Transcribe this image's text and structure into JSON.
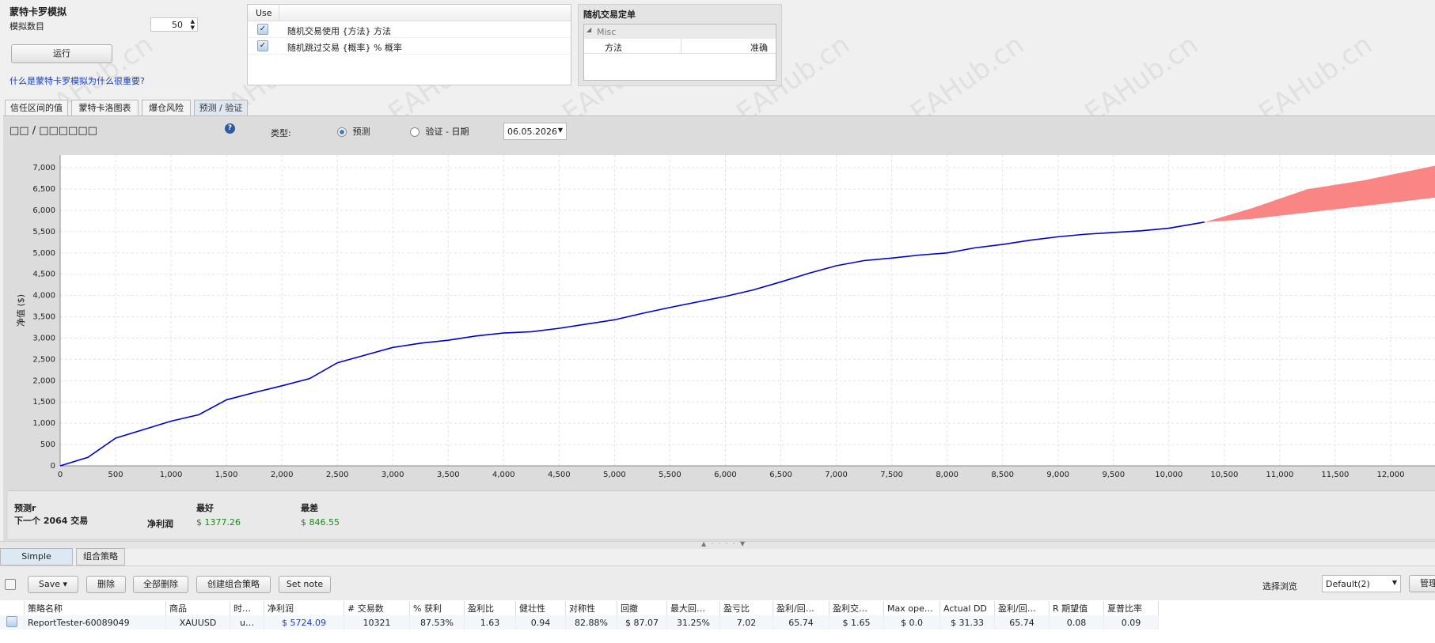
{
  "sim": {
    "title": "蒙特卡罗模拟",
    "count_label": "模拟数目",
    "count_value": "50",
    "run_button": "运行",
    "help_link": "什么是蒙特卡罗模拟为什么很重要?"
  },
  "options_table": {
    "header_use": "Use",
    "rows": [
      {
        "checked": "✓",
        "label": "随机交易使用 {方法} 方法"
      },
      {
        "checked": "✓",
        "label": "随机跳过交易 {概率} % 概率"
      }
    ]
  },
  "props": {
    "title": "随机交易定单",
    "group": "Misc",
    "key": "方法",
    "value": "准确"
  },
  "tabs": [
    "信任区间的值",
    "蒙特卡洛图表",
    "爆仓风险",
    "预测 / 验证"
  ],
  "toolbar": {
    "section_title": "□□ / □□□□□□",
    "help_icon": "?",
    "type_label": "类型:",
    "opt_predict": "预测",
    "opt_validate": "验证 - 日期",
    "date_value": "06.05.2026"
  },
  "chart_data": {
    "type": "line",
    "ylabel": "净值 ($)",
    "xlim": [
      0,
      12400
    ],
    "ylim": [
      0,
      7300
    ],
    "x_ticks": [
      0,
      500,
      1000,
      1500,
      2000,
      2500,
      3000,
      3500,
      4000,
      4500,
      5000,
      5500,
      6000,
      6500,
      7000,
      7500,
      8000,
      8500,
      9000,
      9500,
      10000,
      10500,
      11000,
      11500,
      12000
    ],
    "x_tick_labels": [
      "0",
      "500",
      "1,000",
      "1,500",
      "2,000",
      "2,500",
      "3,000",
      "3,500",
      "4,000",
      "4,500",
      "5,000",
      "5,500",
      "6,000",
      "6,500",
      "7,000",
      "7,500",
      "8,000",
      "8,500",
      "9,000",
      "9,500",
      "10,000",
      "10,500",
      "11,000",
      "11,500",
      "12,000"
    ],
    "y_ticks": [
      0,
      500,
      1000,
      1500,
      2000,
      2500,
      3000,
      3500,
      4000,
      4500,
      5000,
      5500,
      6000,
      6500,
      7000
    ],
    "y_tick_labels": [
      "0",
      "500",
      "1,000",
      "1,500",
      "2,000",
      "2,500",
      "3,000",
      "3,500",
      "4,000",
      "4,500",
      "5,000",
      "5,500",
      "6,000",
      "6,500",
      "7,000"
    ],
    "grid": true,
    "series": [
      {
        "color": "#0000cc",
        "x": [
          0,
          250,
          500,
          750,
          1000,
          1250,
          1500,
          1750,
          2000,
          2250,
          2500,
          2750,
          3000,
          3250,
          3500,
          3750,
          4000,
          4250,
          4500,
          4750,
          5000,
          5250,
          5500,
          5750,
          6000,
          6250,
          6500,
          6750,
          7000,
          7250,
          7500,
          7750,
          8000,
          8250,
          8500,
          8750,
          9000,
          9250,
          9500,
          9750,
          10000,
          10321
        ],
        "y": [
          0,
          200,
          650,
          850,
          1050,
          1200,
          1550,
          1720,
          1880,
          2050,
          2420,
          2600,
          2780,
          2880,
          2950,
          3050,
          3120,
          3150,
          3230,
          3330,
          3430,
          3580,
          3720,
          3850,
          3980,
          4130,
          4320,
          4520,
          4700,
          4820,
          4880,
          4950,
          5000,
          5120,
          5200,
          5300,
          5380,
          5440,
          5480,
          5520,
          5580,
          5724
        ]
      }
    ],
    "forecast_band": {
      "color": "#f87878",
      "x": [
        10321,
        10750,
        11250,
        11750,
        12400
      ],
      "y_low": [
        5724,
        5800,
        5950,
        6100,
        6300
      ],
      "y_high": [
        5724,
        6050,
        6500,
        6700,
        7050
      ]
    }
  },
  "forecast": {
    "label1": "预测r",
    "label2": "下一个 2064 交易",
    "col_best": "最好",
    "col_worst": "最差",
    "row_label": "净利润",
    "best_value": "$ 1377.26",
    "worst_value": "$ 846.55"
  },
  "bottom_tabs": [
    "Simple strategies",
    "组合策略"
  ],
  "bottom_toolbar": {
    "save": "Save ▾",
    "delete": "删除",
    "delete_all": "全部删除",
    "create_portfolio": "创建组合策略",
    "set_note": "Set note",
    "view_label": "选择浏览",
    "view_value": "Default(2)",
    "manage": "管理"
  },
  "results_table": {
    "columns": [
      "策略名称",
      "商品",
      "时…",
      "净利润",
      "# 交易数",
      "% 获利",
      "盈利比",
      "健壮性",
      "对称性",
      "回撤",
      "最大回…",
      "盈亏比",
      "盈利/回…",
      "盈利交…",
      "Max ope…",
      "Actual DD",
      "盈利/回…",
      "R 期望值",
      "夏普比率"
    ],
    "rows": [
      [
        "ReportTester-60089049",
        "XAUUSD",
        "u…",
        "$ 5724.09",
        "10321",
        "87.53%",
        "1.63",
        "0.94",
        "82.88%",
        "$ 87.07",
        "31.25%",
        "7.02",
        "65.74",
        "$ 1.65",
        "$ 0.0",
        "$ 31.33",
        "65.74",
        "0.08",
        "0.09"
      ]
    ]
  },
  "watermark": "EAHub.cn"
}
